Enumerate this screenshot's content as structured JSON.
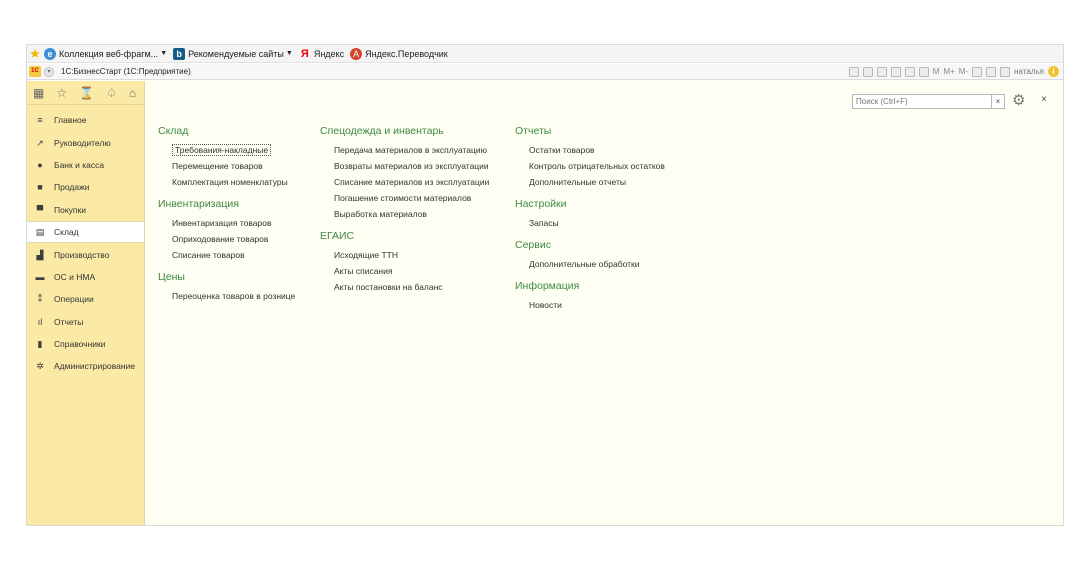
{
  "favorites_bar": {
    "items": [
      {
        "label": "Коллекция веб-фрагм...",
        "icon": "ie-icon",
        "dropdown": true
      },
      {
        "label": "Рекомендуемые сайты",
        "icon": "bing-icon",
        "dropdown": true
      },
      {
        "label": "Яндекс",
        "icon": "yandex-icon",
        "dropdown": false
      },
      {
        "label": "Яндекс.Переводчик",
        "icon": "translator-icon",
        "dropdown": false
      }
    ]
  },
  "titlebar": {
    "title": "1С:БизнесСтарт  (1С:Предприятие)",
    "m_labels": [
      "M",
      "M+",
      "M-"
    ],
    "user": "наталья"
  },
  "sidebar": {
    "tools": [
      "apps-grid-icon",
      "star-icon",
      "history-icon",
      "bell-icon",
      "home-icon"
    ],
    "items": [
      {
        "label": "Главное",
        "icon": "menu-icon"
      },
      {
        "label": "Руководителю",
        "icon": "trend-icon"
      },
      {
        "label": "Банк и касса",
        "icon": "coin-icon"
      },
      {
        "label": "Продажи",
        "icon": "bag-icon"
      },
      {
        "label": "Покупки",
        "icon": "cart-icon"
      },
      {
        "label": "Склад",
        "icon": "warehouse-icon",
        "active": true
      },
      {
        "label": "Производство",
        "icon": "factory-icon"
      },
      {
        "label": "ОС и НМА",
        "icon": "truck-icon"
      },
      {
        "label": "Операции",
        "icon": "operations-icon"
      },
      {
        "label": "Отчеты",
        "icon": "chart-icon"
      },
      {
        "label": "Справочники",
        "icon": "book-icon"
      },
      {
        "label": "Администрирование",
        "icon": "gear-icon"
      }
    ]
  },
  "search": {
    "placeholder": "Поиск (Ctrl+F)",
    "clear": "×"
  },
  "close_label": "×",
  "columns": [
    {
      "sections": [
        {
          "title": "Склад",
          "links": [
            "Требования-накладные",
            "Перемещение товаров",
            "Комплектация номенклатуры"
          ]
        },
        {
          "title": "Инвентаризация",
          "links": [
            "Инвентаризация товаров",
            "Оприходование товаров",
            "Списание товаров"
          ]
        },
        {
          "title": "Цены",
          "links": [
            "Переоценка товаров в рознице"
          ]
        }
      ]
    },
    {
      "sections": [
        {
          "title": "Спецодежда и инвентарь",
          "links": [
            "Передача материалов в эксплуатацию",
            "Возвраты материалов из эксплуатации",
            "Списание материалов из эксплуатации",
            "Погашение стоимости материалов",
            "Выработка материалов"
          ]
        },
        {
          "title": "ЕГАИС",
          "links": [
            "Исходящие ТТН",
            "Акты списания",
            "Акты постановки на баланс"
          ]
        }
      ]
    },
    {
      "sections": [
        {
          "title": "Отчеты",
          "links": [
            "Остатки товаров",
            "Контроль отрицательных остатков",
            "Дополнительные отчеты"
          ]
        },
        {
          "title": "Настройки",
          "links": [
            "Запасы"
          ]
        },
        {
          "title": "Сервис",
          "links": [
            "Дополнительные обработки"
          ]
        },
        {
          "title": "Информация",
          "links": [
            "Новости"
          ]
        }
      ]
    }
  ]
}
